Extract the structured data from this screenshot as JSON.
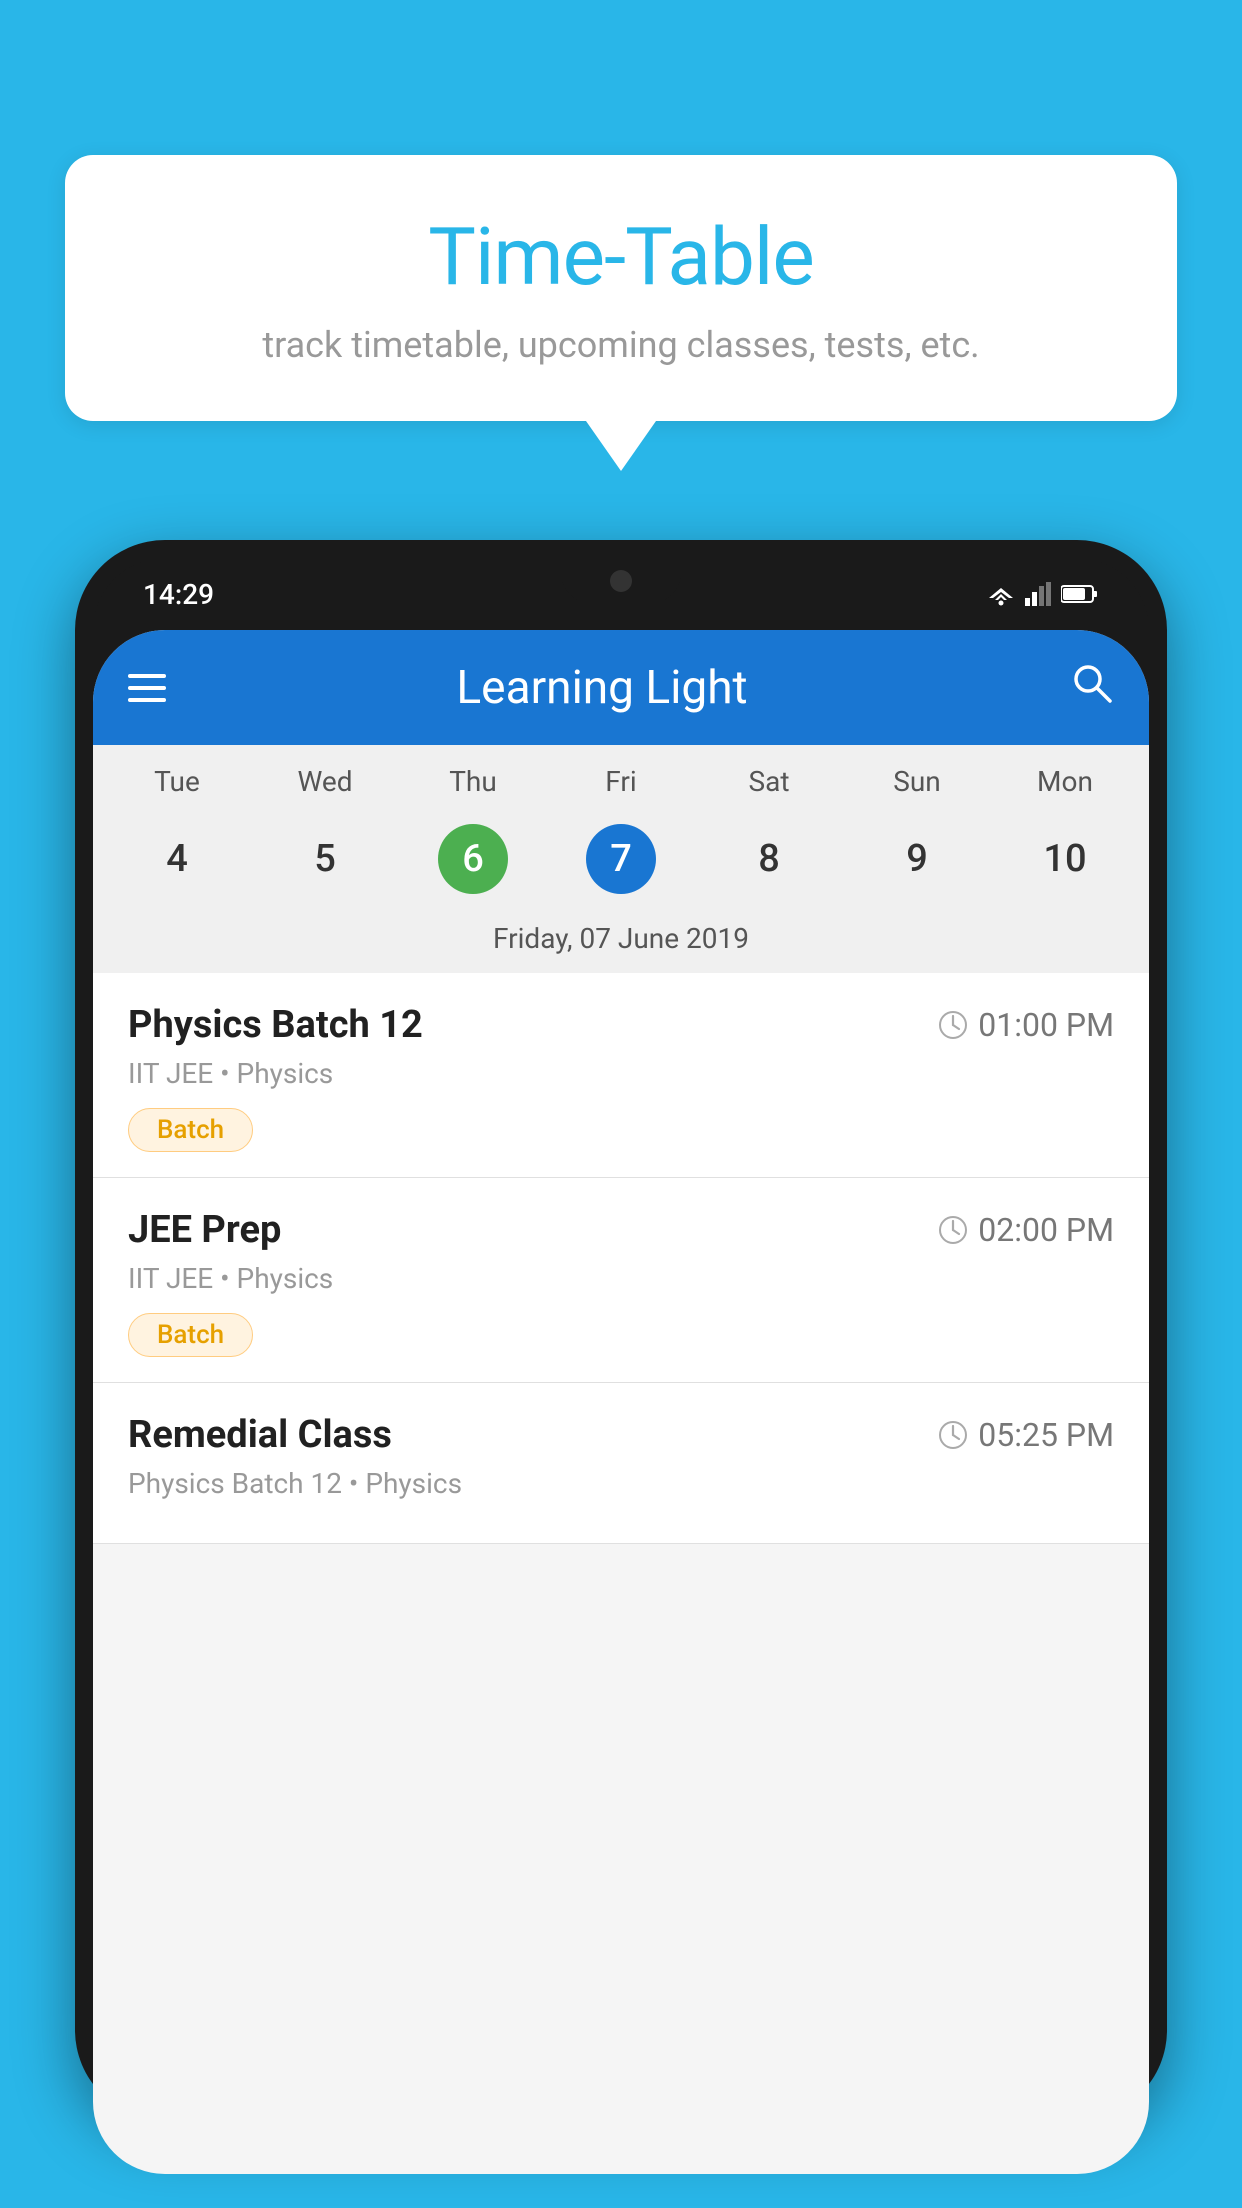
{
  "background_color": "#29b6e8",
  "speech_bubble": {
    "title": "Time-Table",
    "subtitle": "track timetable, upcoming classes, tests, etc."
  },
  "app_bar": {
    "title": "Learning Light"
  },
  "status_bar": {
    "time": "14:29"
  },
  "calendar": {
    "selected_date_label": "Friday, 07 June 2019",
    "days": [
      {
        "label": "Tue",
        "num": "4",
        "state": "normal"
      },
      {
        "label": "Wed",
        "num": "5",
        "state": "normal"
      },
      {
        "label": "Thu",
        "num": "6",
        "state": "today"
      },
      {
        "label": "Fri",
        "num": "7",
        "state": "selected"
      },
      {
        "label": "Sat",
        "num": "8",
        "state": "normal"
      },
      {
        "label": "Sun",
        "num": "9",
        "state": "normal"
      },
      {
        "label": "Mon",
        "num": "10",
        "state": "normal"
      }
    ]
  },
  "classes": [
    {
      "name": "Physics Batch 12",
      "time": "01:00 PM",
      "meta": "IIT JEE • Physics",
      "tag": "Batch"
    },
    {
      "name": "JEE Prep",
      "time": "02:00 PM",
      "meta": "IIT JEE • Physics",
      "tag": "Batch"
    },
    {
      "name": "Remedial Class",
      "time": "05:25 PM",
      "meta": "Physics Batch 12 • Physics",
      "tag": ""
    }
  ]
}
